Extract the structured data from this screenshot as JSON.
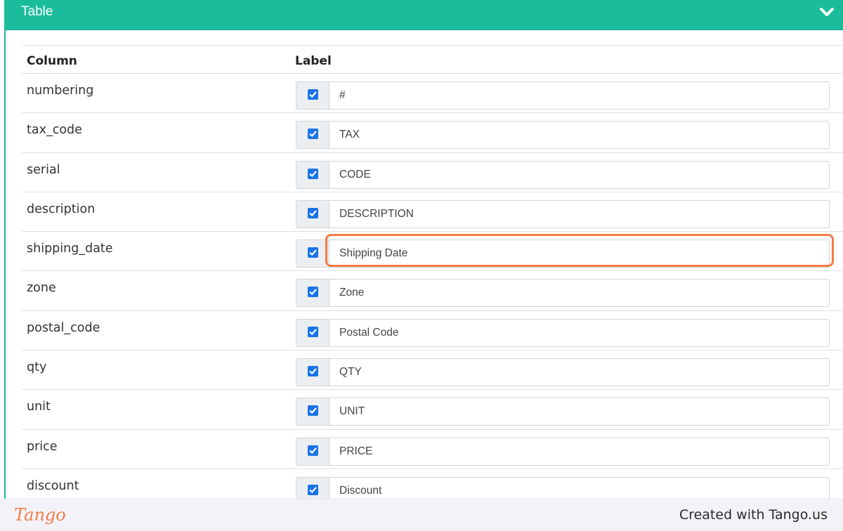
{
  "panel": {
    "title": "Table"
  },
  "table": {
    "headers": {
      "column": "Column",
      "label": "Label"
    },
    "rows": [
      {
        "column": "numbering",
        "label": "#",
        "checked": true
      },
      {
        "column": "tax_code",
        "label": "TAX",
        "checked": true
      },
      {
        "column": "serial",
        "label": "CODE",
        "checked": true
      },
      {
        "column": "description",
        "label": "DESCRIPTION",
        "checked": true
      },
      {
        "column": "shipping_date",
        "label": "Shipping Date",
        "checked": true
      },
      {
        "column": "zone",
        "label": "Zone",
        "checked": true
      },
      {
        "column": "postal_code",
        "label": "Postal Code",
        "checked": true
      },
      {
        "column": "qty",
        "label": "QTY",
        "checked": true
      },
      {
        "column": "unit",
        "label": "UNIT",
        "checked": true
      },
      {
        "column": "price",
        "label": "PRICE",
        "checked": true
      },
      {
        "column": "discount",
        "label": "Discount",
        "checked": true
      }
    ]
  },
  "footer": {
    "brand": "Tango",
    "credit": "Created with Tango.us"
  },
  "colors": {
    "header": "#1abc9c",
    "checkbox": "#1a73e8",
    "highlight": "#f47c45"
  },
  "icons": {
    "collapse": "chevron-down-icon",
    "check": "check-icon"
  }
}
